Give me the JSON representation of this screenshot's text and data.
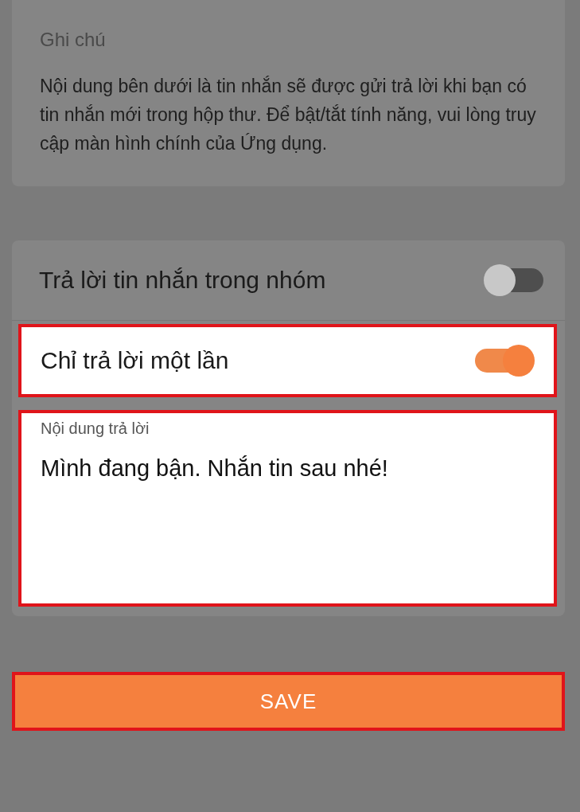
{
  "note": {
    "title": "Ghi chú",
    "text": "Nội dung bên dưới là tin nhắn sẽ được gửi trả lời khi bạn có tin nhắn mới trong hộp thư. Để bật/tắt tính năng, vui lòng truy cập màn hình chính của Ứng dụng."
  },
  "settings": [
    {
      "label": "Trả lời tin nhắn trong nhóm",
      "on": false,
      "highlighted": false
    },
    {
      "label": "Chỉ trả lời một lần",
      "on": true,
      "highlighted": true
    }
  ],
  "reply": {
    "label": "Nội dung trả lời",
    "value": "Mình đang bận. Nhắn tin sau nhé!",
    "highlighted": true
  },
  "save": {
    "label": "SAVE",
    "highlighted": true
  }
}
